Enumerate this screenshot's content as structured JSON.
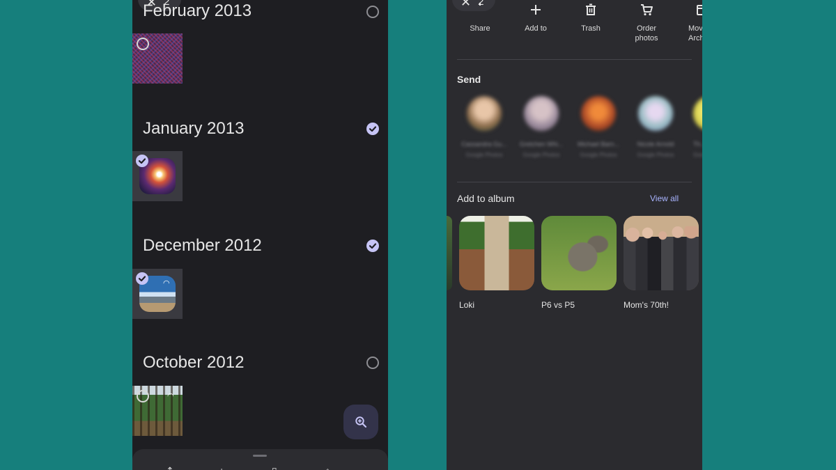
{
  "left": {
    "selection_count": "2",
    "months": [
      {
        "title": "February 2013",
        "selected": false
      },
      {
        "title": "January 2013",
        "selected": true
      },
      {
        "title": "December 2012",
        "selected": true
      },
      {
        "title": "October 2012",
        "selected": false
      }
    ]
  },
  "right": {
    "selection_count": "2",
    "actions": [
      {
        "label": "Share",
        "icon": "share-icon"
      },
      {
        "label": "Add to",
        "icon": "plus-icon"
      },
      {
        "label": "Trash",
        "icon": "trash-icon"
      },
      {
        "label": "Order\nphotos",
        "icon": "cart-icon"
      },
      {
        "label": "Move\nArchi",
        "icon": "archive-icon"
      }
    ],
    "send_title": "Send",
    "contacts": [
      {
        "name": "Cassandra Gu...",
        "sub": "Google Photos",
        "color": "#b98a6a"
      },
      {
        "name": "Gretchen Whi...",
        "sub": "Google Photos",
        "color": "#a89aa6"
      },
      {
        "name": "Michael Barn...",
        "sub": "Google Photos",
        "color": "#b4502a"
      },
      {
        "name": "Nicole Arnold",
        "sub": "Google Photos",
        "color": "#9ec0c6"
      },
      {
        "name": "Th...",
        "sub": "Goo...",
        "color": "#d8d050"
      }
    ],
    "album_title": "Add to album",
    "view_all": "View all",
    "albums": [
      {
        "name": "Loki",
        "art": "bridge"
      },
      {
        "name": "P6 vs P5",
        "art": "dog"
      },
      {
        "name": "Mom's 70th!",
        "art": "family"
      }
    ]
  }
}
